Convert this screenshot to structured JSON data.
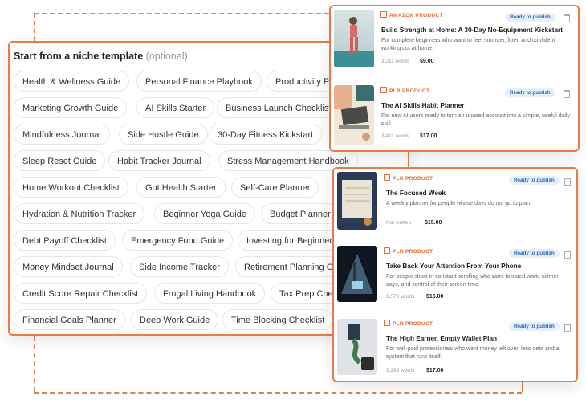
{
  "templates": {
    "heading": "Start from a niche template",
    "optional": "(optional)",
    "rows": [
      [
        "Health & Wellness Guide",
        "Personal Finance Playbook",
        "Productivity Planner"
      ],
      [
        "Marketing Growth Guide",
        "AI Skills Starter",
        "Business Launch Checklist"
      ],
      [
        "Mindfulness Journal",
        "Side Hustle Guide",
        "30-Day Fitness Kickstart"
      ],
      [
        "Sleep Reset Guide",
        "Habit Tracker Journal",
        "Stress Management Handbook"
      ],
      [
        "Home Workout Checklist",
        "Gut Health Starter",
        "Self-Care Planner"
      ],
      [
        "Hydration & Nutrition Tracker",
        "Beginner Yoga Guide",
        "Budget Planner"
      ],
      [
        "Debt Payoff Checklist",
        "Emergency Fund Guide",
        "Investing for Beginners"
      ],
      [
        "Money Mindset Journal",
        "Side Income Tracker",
        "Retirement Planning Guide"
      ],
      [
        "Credit Score Repair Checklist",
        "Frugal Living Handbook",
        "Tax Prep Checklist"
      ],
      [
        "Financial Goals Planner",
        "Deep Work Guide",
        "Time Blocking Checklist"
      ]
    ]
  },
  "products_top": [
    {
      "kind": "AMAZON PRODUCT",
      "title": "Build Strength at Home: A 30-Day No-Equipment Kickstart",
      "desc": "For complete beginners who want to feel stronger, fitter, and confident working out at home.",
      "words": "3,211 words",
      "price": "$9.00",
      "status": "Ready to publish"
    },
    {
      "kind": "PLR PRODUCT",
      "title": "The AI Skills Habit Planner",
      "desc": "For new AI users ready to turn an unused account into a simple, useful daily skill",
      "words": "3,411 words",
      "price": "$17.00",
      "status": "Ready to publish"
    }
  ],
  "products_bottom": [
    {
      "kind": "PLR PRODUCT",
      "title": "The Focused Week",
      "desc": "A weekly planner for people whose days do not go to plan.",
      "words": "Not written",
      "price": "$15.00",
      "status": "Ready to publish"
    },
    {
      "kind": "PLR PRODUCT",
      "title": "Take Back Your Attention From Your Phone",
      "desc": "For people stuck in constant scrolling who want focused work, calmer days, and control of their screen time.",
      "words": "3,573 words",
      "price": "$15.00",
      "status": "Ready to publish"
    },
    {
      "kind": "PLR PRODUCT",
      "title": "The High Earner, Empty Wallet Plan",
      "desc": "For well-paid professionals who want money left over, less debt and a system that runs itself.",
      "words": "3,283 words",
      "price": "$17.00",
      "status": "Ready to publish"
    }
  ],
  "colors": {
    "accent": "#ec7a45",
    "badge_bg": "#e6f0fb",
    "badge_text": "#2a66b0"
  }
}
